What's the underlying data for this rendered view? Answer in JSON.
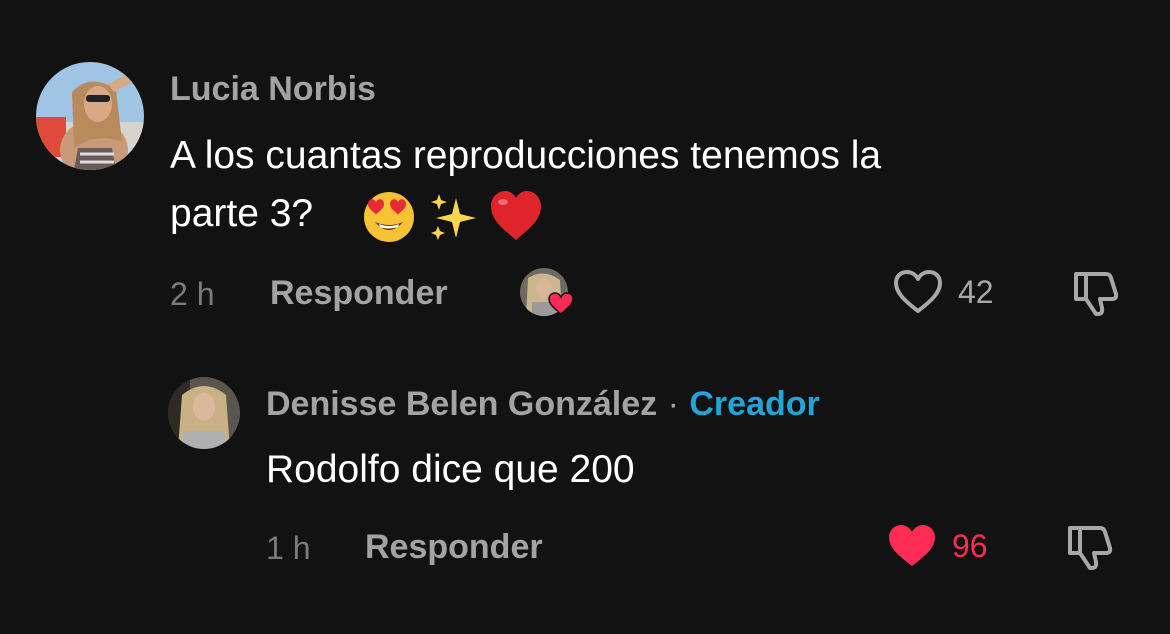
{
  "comment": {
    "author": "Lucia Norbis",
    "text_line1": "A los cuantas reproducciones tenemos la",
    "text_line2": "parte 3?",
    "emojis": [
      "heart-eyes-emoji",
      "sparkles-emoji",
      "red-heart-emoji"
    ],
    "time": "2 h",
    "reply_label": "Responder",
    "likes": "42",
    "liked": false
  },
  "reply": {
    "author": "Denisse Belen González",
    "separator": "·",
    "badge": "Creador",
    "text": "Rodolfo dice que 200",
    "time": "1 h",
    "reply_label": "Responder",
    "likes": "96",
    "liked": true
  },
  "colors": {
    "background": "#121212",
    "like_active": "#fe2c55",
    "creator_badge": "#20a5d8"
  }
}
